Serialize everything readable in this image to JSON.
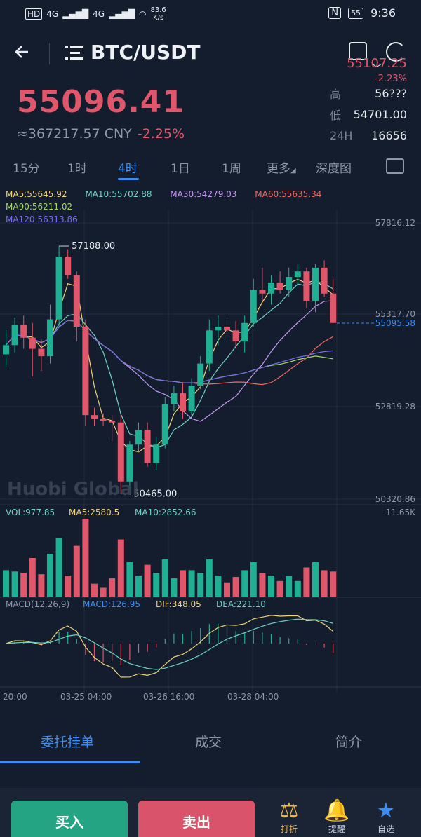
{
  "status": {
    "hd": "HD",
    "net1": "4G",
    "net2": "4G",
    "speed": "83.6",
    "speed_unit": "K/s",
    "nfc": "N",
    "battery": "55",
    "time": "9:36"
  },
  "header": {
    "back_icon": "arrow-left-icon",
    "pair": "BTC/USDT"
  },
  "ghost": {
    "price": "55107.25",
    "chg": "-2.23%"
  },
  "ticker": {
    "price": "55096.41",
    "cny": "≈367217.57 CNY",
    "change": "-2.25%",
    "high_label": "高",
    "high": "56???",
    "low_label": "低",
    "low": "54701.00",
    "vol_label": "24H",
    "vol": "16656"
  },
  "timeframes": [
    "15分",
    "1时",
    "4时",
    "1日",
    "1周",
    "更多",
    "深度图"
  ],
  "ma": {
    "ma5": "MA5:55645.92",
    "ma10": "MA10:55702.88",
    "ma30": "MA30:54279.03",
    "ma60": "MA60:55635.34",
    "ma90": "MA90:56211.02",
    "ma120": "MA120:56313.86"
  },
  "chart_data": {
    "type": "candlestick",
    "y_ticks": [
      "57816.12",
      "55317.70",
      "52819.28",
      "50320.86"
    ],
    "current_price_label": "55095.58",
    "high_marker": "57188.00",
    "low_marker": "50465.00",
    "watermark": "Huobi Global",
    "x_ticks": [
      "20:00",
      "03-25 04:00",
      "03-26 16:00",
      "03-28 04:00"
    ],
    "vol_bar": {
      "vol": "VOL:977.85",
      "ma5": "MA5:2580.5",
      "ma10": "MA10:2852.66",
      "max": "11.65K"
    },
    "macd_bar": {
      "params": "MACD(12,26,9)",
      "macd": "MACD:126.95",
      "dif": "DIF:348.05",
      "dea": "DEA:221.10"
    },
    "candles": [
      [
        54250,
        54900,
        53900,
        54500
      ],
      [
        54500,
        55250,
        54300,
        55050
      ],
      [
        55050,
        55300,
        54400,
        54700
      ],
      [
        54700,
        55100,
        53650,
        54400
      ],
      [
        54400,
        54650,
        53800,
        54200
      ],
      [
        54200,
        55600,
        54000,
        55200
      ],
      [
        55200,
        57188,
        55000,
        56900
      ],
      [
        56900,
        57100,
        56300,
        56400
      ],
      [
        56400,
        56500,
        54600,
        55000
      ],
      [
        55000,
        55200,
        52300,
        52600
      ],
      [
        52600,
        52800,
        52300,
        52500
      ],
      [
        52500,
        52650,
        52300,
        52450
      ],
      [
        52450,
        52600,
        51900,
        52400
      ],
      [
        52400,
        52600,
        50465,
        50800
      ],
      [
        50800,
        51900,
        50600,
        51800
      ],
      [
        51800,
        52400,
        51600,
        52200
      ],
      [
        52200,
        52400,
        51200,
        51300
      ],
      [
        51300,
        52000,
        51100,
        51800
      ],
      [
        51800,
        53100,
        51700,
        52900
      ],
      [
        52900,
        53400,
        52700,
        53200
      ],
      [
        53200,
        53500,
        52500,
        52700
      ],
      [
        52700,
        53600,
        52600,
        53400
      ],
      [
        53400,
        54200,
        53300,
        54000
      ],
      [
        54000,
        55200,
        53800,
        54900
      ],
      [
        54900,
        55300,
        54500,
        55000
      ],
      [
        55000,
        55250,
        54700,
        54900
      ],
      [
        54900,
        55150,
        54400,
        54600
      ],
      [
        54600,
        55300,
        54300,
        55100
      ],
      [
        55100,
        56300,
        55000,
        56000
      ],
      [
        56000,
        56600,
        55700,
        55900
      ],
      [
        55900,
        56400,
        55600,
        56200
      ],
      [
        56200,
        56500,
        55900,
        56000
      ],
      [
        56000,
        56600,
        55800,
        56350
      ],
      [
        56350,
        56700,
        56100,
        56500
      ],
      [
        56500,
        56600,
        55500,
        55700
      ],
      [
        55700,
        56700,
        55400,
        56600
      ],
      [
        56600,
        56800,
        55800,
        55900
      ],
      [
        55900,
        56300,
        55350,
        55100
      ]
    ]
  },
  "tabs": {
    "orders": "委托挂单",
    "trades": "成交",
    "intro": "简介"
  },
  "bottombar": {
    "buy": "买入",
    "sell": "卖出",
    "grid": "打折",
    "alert": "提醒",
    "fav": "自选"
  },
  "colors": {
    "up": "#1fb094",
    "down": "#e0566a",
    "accent": "#3e8df0",
    "bg": "#141d2e"
  }
}
